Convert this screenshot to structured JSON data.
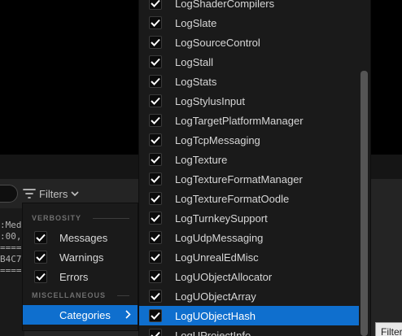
{
  "toolbar": {
    "filters_label": "Filters"
  },
  "log_fragments": [
    ":Medi",
    ":00,",
    "====",
    "B4C7",
    "===="
  ],
  "tooltip_text": "Filter",
  "filters_menu": {
    "verbosity_header": "VERBOSITY",
    "misc_header": "MISCELLANEOUS",
    "items": [
      {
        "label": "Messages",
        "checked": true
      },
      {
        "label": "Warnings",
        "checked": true
      },
      {
        "label": "Errors",
        "checked": true
      }
    ],
    "categories_label": "Categories"
  },
  "categories": [
    {
      "label": "LogShaderCompilers",
      "checked": true
    },
    {
      "label": "LogSlate",
      "checked": true
    },
    {
      "label": "LogSourceControl",
      "checked": true
    },
    {
      "label": "LogStall",
      "checked": true
    },
    {
      "label": "LogStats",
      "checked": true
    },
    {
      "label": "LogStylusInput",
      "checked": true
    },
    {
      "label": "LogTargetPlatformManager",
      "checked": true
    },
    {
      "label": "LogTcpMessaging",
      "checked": true
    },
    {
      "label": "LogTexture",
      "checked": true
    },
    {
      "label": "LogTextureFormatManager",
      "checked": true
    },
    {
      "label": "LogTextureFormatOodle",
      "checked": true
    },
    {
      "label": "LogTurnkeySupport",
      "checked": true
    },
    {
      "label": "LogUdpMessaging",
      "checked": true
    },
    {
      "label": "LogUnrealEdMisc",
      "checked": true
    },
    {
      "label": "LogUObjectAllocator",
      "checked": true
    },
    {
      "label": "LogUObjectArray",
      "checked": true
    },
    {
      "label": "LogUObjectHash",
      "checked": true,
      "highlighted": true
    },
    {
      "label": "LogUProjectInfo",
      "checked": true
    }
  ],
  "colors": {
    "highlight": "#0f6fce",
    "menu_bg": "#1a1a1a",
    "panel_bg": "#242424"
  }
}
